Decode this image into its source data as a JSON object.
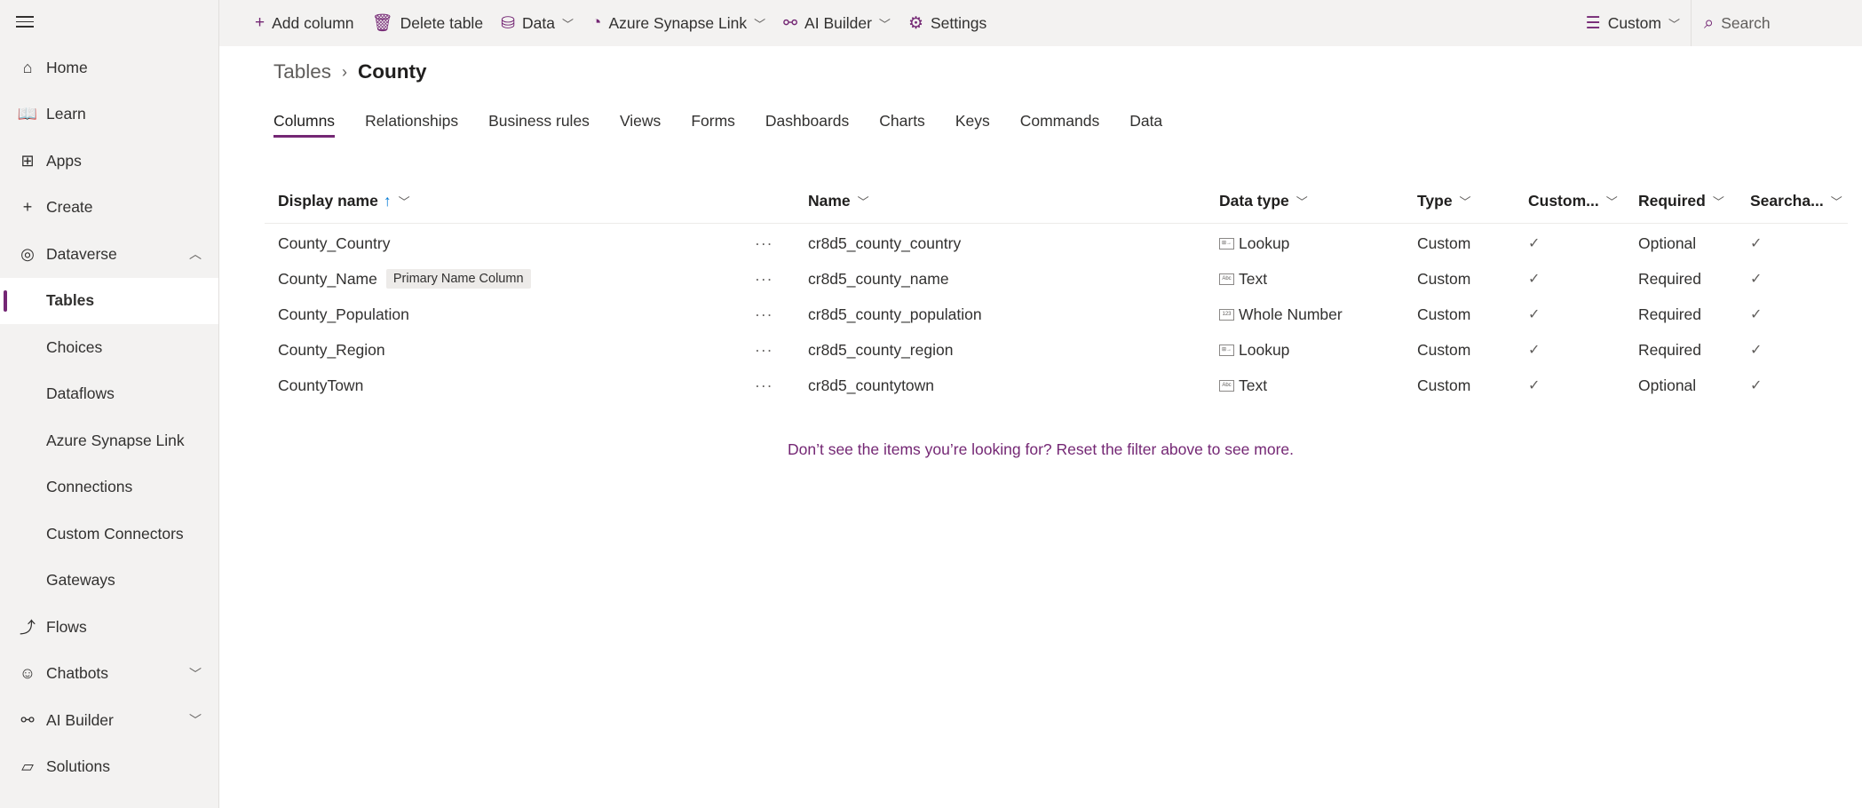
{
  "sidebar": {
    "items": [
      {
        "label": "Home",
        "icon": "home-icon",
        "glyph": "⌂"
      },
      {
        "label": "Learn",
        "icon": "book-icon",
        "glyph": "📖"
      },
      {
        "label": "Apps",
        "icon": "apps-icon",
        "glyph": "⊞"
      },
      {
        "label": "Create",
        "icon": "plus-icon",
        "glyph": "+"
      },
      {
        "label": "Dataverse",
        "icon": "dataverse-icon",
        "glyph": "◎",
        "chev": "︿"
      },
      {
        "label": "Tables",
        "active": true
      },
      {
        "label": "Choices"
      },
      {
        "label": "Dataflows"
      },
      {
        "label": "Azure Synapse Link"
      },
      {
        "label": "Connections"
      },
      {
        "label": "Custom Connectors"
      },
      {
        "label": "Gateways"
      },
      {
        "label": "Flows",
        "icon": "flows-icon",
        "glyph": "⤴"
      },
      {
        "label": "Chatbots",
        "icon": "chatbot-icon",
        "glyph": "☺",
        "chev": "﹀"
      },
      {
        "label": "AI Builder",
        "icon": "ai-builder-icon",
        "glyph": "⚯",
        "chev": "﹀"
      },
      {
        "label": "Solutions",
        "icon": "solutions-icon",
        "glyph": "▱"
      }
    ]
  },
  "toolbar": {
    "add_column": "Add column",
    "delete_table": "Delete table",
    "data": "Data",
    "synapse": "Azure Synapse Link",
    "ai_builder": "AI Builder",
    "settings": "Settings",
    "view": "Custom",
    "search_placeholder": "Search"
  },
  "breadcrumb": {
    "parent": "Tables",
    "current": "County"
  },
  "tabs": [
    "Columns",
    "Relationships",
    "Business rules",
    "Views",
    "Forms",
    "Dashboards",
    "Charts",
    "Keys",
    "Commands",
    "Data"
  ],
  "table": {
    "headers": {
      "display_name": "Display name",
      "name": "Name",
      "data_type": "Data type",
      "type": "Type",
      "customizable": "Custom...",
      "required": "Required",
      "searchable": "Searcha..."
    },
    "rows": [
      {
        "display": "County_Country",
        "badge": "",
        "name": "cr8d5_county_country",
        "dtype": "Lookup",
        "dicon": "lookup-icon",
        "type": "Custom",
        "custom": "✓",
        "required": "Optional",
        "searchable": "✓"
      },
      {
        "display": "County_Name",
        "badge": "Primary Name Column",
        "name": "cr8d5_county_name",
        "dtype": "Text",
        "dicon": "text-icon",
        "type": "Custom",
        "custom": "✓",
        "required": "Required",
        "searchable": "✓"
      },
      {
        "display": "County_Population",
        "badge": "",
        "name": "cr8d5_county_population",
        "dtype": "Whole Number",
        "dicon": "number-icon",
        "type": "Custom",
        "custom": "✓",
        "required": "Required",
        "searchable": "✓"
      },
      {
        "display": "County_Region",
        "badge": "",
        "name": "cr8d5_county_region",
        "dtype": "Lookup",
        "dicon": "lookup-icon",
        "type": "Custom",
        "custom": "✓",
        "required": "Required",
        "searchable": "✓"
      },
      {
        "display": "CountyTown",
        "badge": "",
        "name": "cr8d5_countytown",
        "dtype": "Text",
        "dicon": "text-icon",
        "type": "Custom",
        "custom": "✓",
        "required": "Optional",
        "searchable": "✓"
      }
    ]
  },
  "message": "Don’t see the items you’re looking for? Reset the filter above to see more.",
  "colors": {
    "accent": "#742774",
    "sidebar_bg": "#f3f2f1"
  }
}
